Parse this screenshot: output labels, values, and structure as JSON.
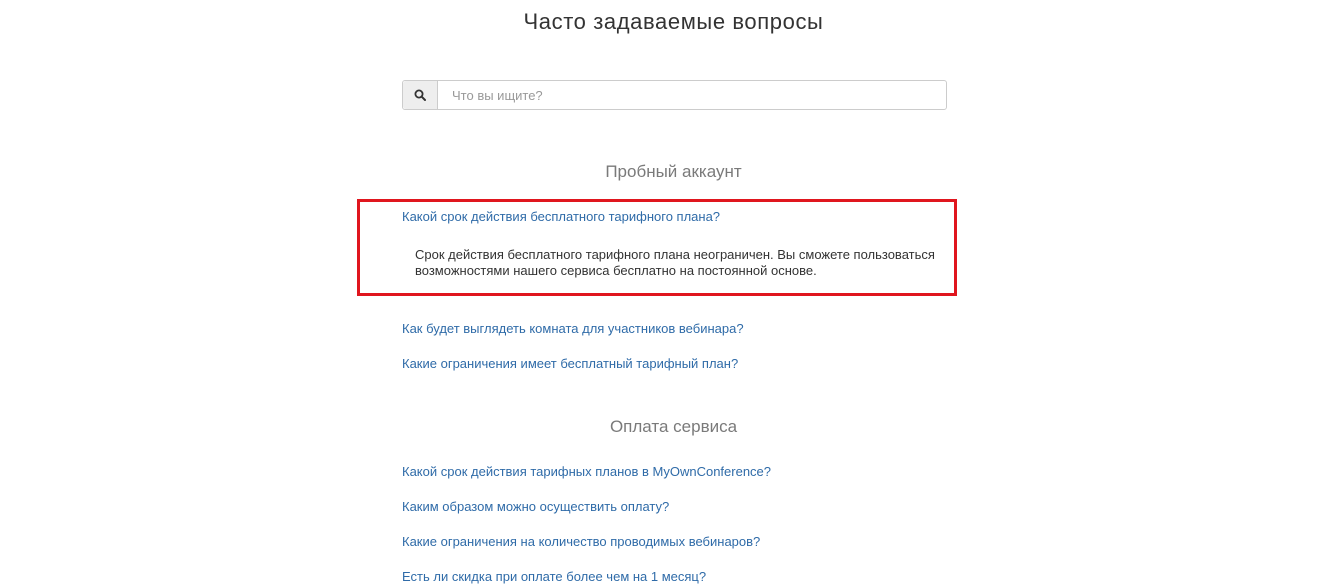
{
  "page": {
    "title": "Часто задаваемые вопросы"
  },
  "search": {
    "icon": "search-icon",
    "placeholder": "Что вы ищите?"
  },
  "sections": [
    {
      "heading": "Пробный аккаунт",
      "questions": [
        {
          "text": "Какой срок действия бесплатного тарифного плана?",
          "answer": "Срок действия бесплатного тарифного плана неограничен. Вы сможете пользоваться возможностями нашего сервиса бесплатно на постоянной основе.",
          "expanded": true
        },
        {
          "text": "Как будет выглядеть комната для участников вебинара?"
        },
        {
          "text": "Какие ограничения имеет бесплатный тарифный план?"
        }
      ]
    },
    {
      "heading": "Оплата сервиса",
      "questions": [
        {
          "text": "Какой срок действия тарифных планов в MyOwnConference?"
        },
        {
          "text": "Каким образом можно осуществить оплату?"
        },
        {
          "text": "Какие ограничения на количество проводимых вебинаров?"
        },
        {
          "text": "Есть ли скидка при оплате более чем на 1 месяц?"
        }
      ]
    }
  ],
  "colors": {
    "link": "#2f6ba8",
    "highlight": "#e0161e",
    "heading": "#7a7a7a"
  }
}
